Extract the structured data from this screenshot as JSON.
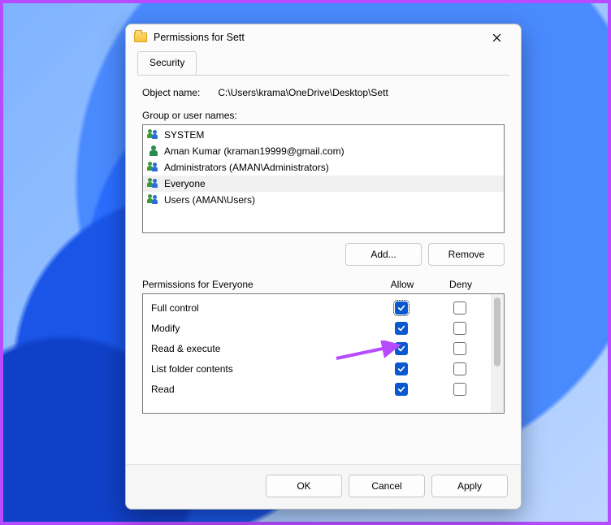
{
  "window": {
    "title": "Permissions for Sett"
  },
  "tab": {
    "security": "Security"
  },
  "object": {
    "label": "Object name:",
    "path": "C:\\Users\\krama\\OneDrive\\Desktop\\Sett"
  },
  "groups": {
    "label": "Group or user names:",
    "items": [
      {
        "name": "SYSTEM",
        "icon": "duo",
        "selected": false
      },
      {
        "name": "Aman Kumar (kraman19999@gmail.com)",
        "icon": "single",
        "selected": false
      },
      {
        "name": "Administrators (AMAN\\Administrators)",
        "icon": "duo",
        "selected": false
      },
      {
        "name": "Everyone",
        "icon": "duo",
        "selected": true
      },
      {
        "name": "Users (AMAN\\Users)",
        "icon": "duo",
        "selected": false
      }
    ]
  },
  "buttons": {
    "add": "Add...",
    "remove": "Remove",
    "ok": "OK",
    "cancel": "Cancel",
    "apply": "Apply"
  },
  "permissions": {
    "header_for": "Permissions for Everyone",
    "col_allow": "Allow",
    "col_deny": "Deny",
    "rows": [
      {
        "name": "Full control",
        "allow": true,
        "deny": false,
        "focus": true
      },
      {
        "name": "Modify",
        "allow": true,
        "deny": false
      },
      {
        "name": "Read & execute",
        "allow": true,
        "deny": false
      },
      {
        "name": "List folder contents",
        "allow": true,
        "deny": false
      },
      {
        "name": "Read",
        "allow": true,
        "deny": false
      }
    ]
  },
  "annotation": {
    "arrow_color": "#b74bff"
  }
}
